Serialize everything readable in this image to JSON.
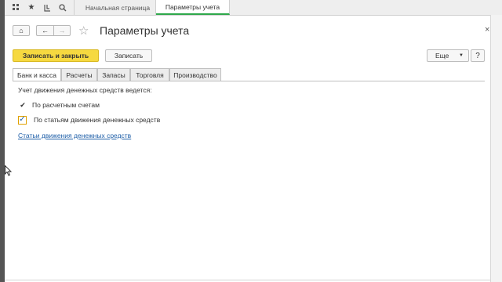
{
  "topbar": {
    "icons": [
      "grid-icon",
      "star-icon",
      "history-icon",
      "search-icon"
    ],
    "tabs": [
      {
        "label": "Начальная страница"
      },
      {
        "label": "Параметры учета"
      }
    ]
  },
  "form": {
    "title": "Параметры учета",
    "close": "×",
    "home_symbol": "⌂",
    "back_symbol": "←",
    "forward_symbol": "→",
    "star_symbol": "☆"
  },
  "commands": {
    "save_close": "Записать и закрыть",
    "save": "Записать",
    "more": "Еще",
    "more_caret": "▼",
    "menu": "?"
  },
  "tabs": [
    {
      "label": "Банк и касса"
    },
    {
      "label": "Расчеты"
    },
    {
      "label": "Запасы"
    },
    {
      "label": "Торговля"
    },
    {
      "label": "Производство"
    }
  ],
  "content": {
    "header": "Учет движения денежных средств ведется:",
    "option1": {
      "label": "По расчетным счетам",
      "mark": "✔"
    },
    "option2": {
      "label": "По статьям движения денежных средств",
      "mark": "✓"
    },
    "link": "Статьи движения денежных средств"
  },
  "colors": {
    "primary_button": "#f6d940",
    "active_tab_underline": "#2ea84a",
    "link": "#1f5fa8",
    "checkbox_border": "#e0a100"
  }
}
